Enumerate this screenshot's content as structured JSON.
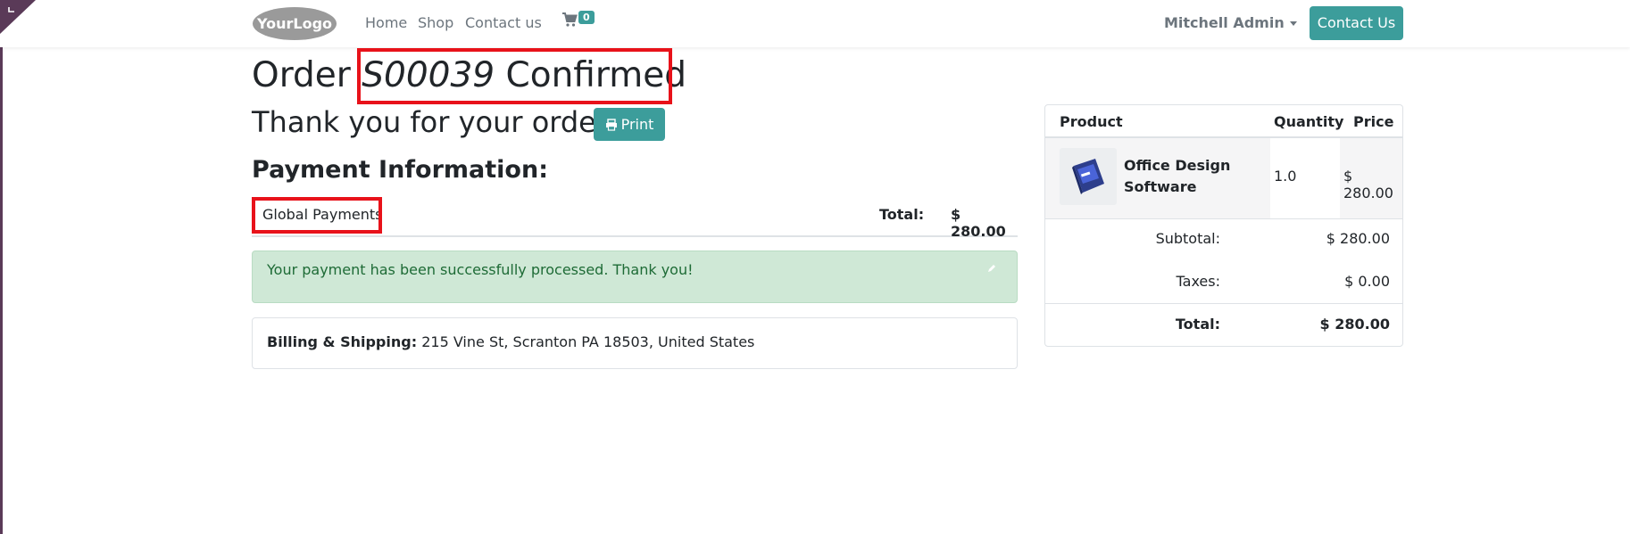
{
  "header": {
    "logo_text": "YourLogo",
    "nav": [
      "Home",
      "Shop",
      "Contact us"
    ],
    "cart_count": "0",
    "user": "Mitchell Admin",
    "contact_button": "Contact Us"
  },
  "order": {
    "prefix": "Order",
    "number": "S00039",
    "status": "Confirmed",
    "thanks": "Thank you for your order.",
    "print_label": "Print"
  },
  "payment": {
    "heading": "Payment Information:",
    "method": "Global Payments",
    "total_label": "Total:",
    "total_value": "$ 280.00",
    "alert": "Your payment has been successfully processed. Thank you!"
  },
  "billing": {
    "label": "Billing & Shipping:",
    "address": "215 Vine St, Scranton PA 18503, United States"
  },
  "summary": {
    "headers": [
      "Product",
      "Quantity",
      "Price"
    ],
    "items": [
      {
        "name": "Office Design Software",
        "qty": "1.0",
        "price": "$ 280.00"
      }
    ],
    "subtotal_label": "Subtotal:",
    "subtotal": "$ 280.00",
    "taxes_label": "Taxes:",
    "taxes": "$ 0.00",
    "total_label": "Total:",
    "total": "$ 280.00"
  },
  "colors": {
    "accent": "#3c9d9b",
    "highlight": "#e8121a",
    "success_bg": "#cfe8d6",
    "success_text": "#1e6b36"
  }
}
